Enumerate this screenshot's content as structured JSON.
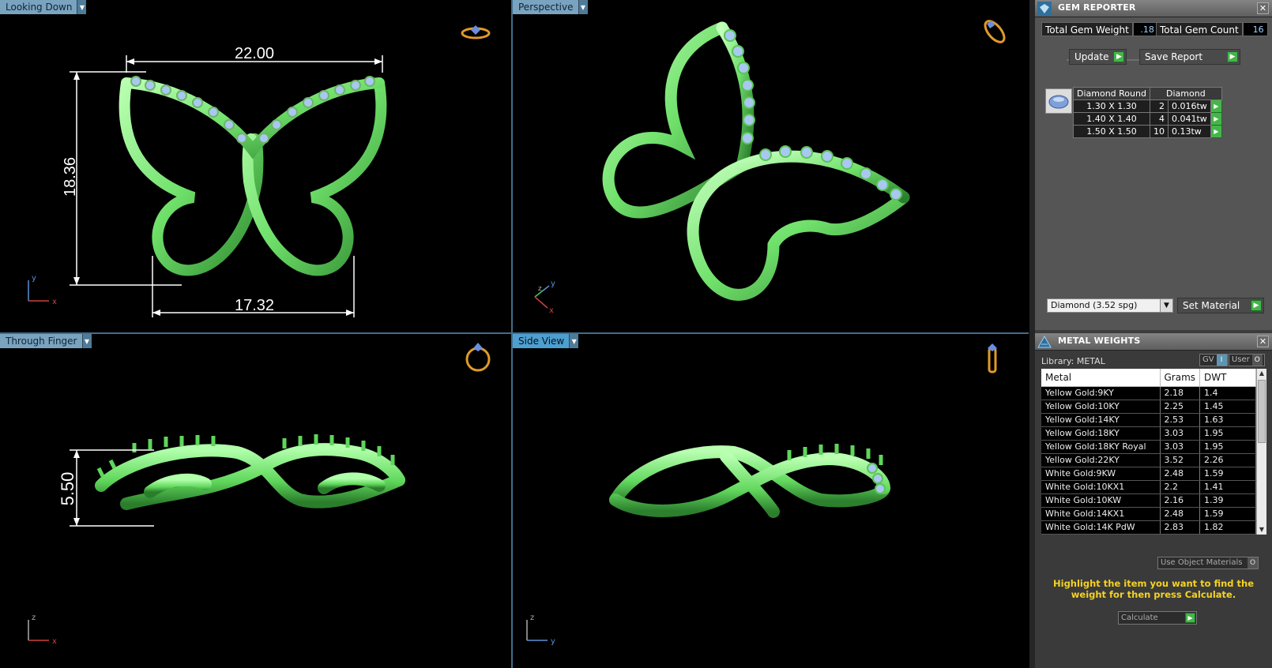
{
  "viewports": {
    "top_left": {
      "label": "Looking Down",
      "dim_width": "22.00",
      "dim_height": "18.36",
      "dim_bottom": "17.32",
      "axis_v": "y",
      "axis_h": "x"
    },
    "top_right": {
      "label": "Perspective",
      "axis_v": "y",
      "axis_z": "z",
      "axis_h": "x"
    },
    "bottom_left": {
      "label": "Through Finger",
      "dim_height": "5.50",
      "axis_v": "z",
      "axis_h": "x"
    },
    "bottom_right": {
      "label": "Side View",
      "axis_v": "z",
      "axis_h": "y"
    }
  },
  "gem_reporter": {
    "title": "GEM REPORTER",
    "close": "✕",
    "total_weight_label": "Total Gem Weight",
    "total_weight_value": ".18",
    "total_count_label": "Total Gem Count",
    "total_count_value": "16",
    "update_label": "Update",
    "save_report_label": "Save Report",
    "table_headers": [
      "Diamond Round",
      "Diamond"
    ],
    "rows": [
      {
        "size": "1.30 X 1.30",
        "count": "2",
        "weight": "0.016tw"
      },
      {
        "size": "1.40 X 1.40",
        "count": "4",
        "weight": "0.041tw"
      },
      {
        "size": "1.50 X 1.50",
        "count": "10",
        "weight": "0.13tw"
      }
    ],
    "material_select": "Diamond    (3.52 spg)",
    "set_material_label": "Set Material"
  },
  "metal_weights": {
    "title": "METAL WEIGHTS",
    "close": "✕",
    "library_label": "Library: METAL",
    "gv_label": "GV",
    "gv_indicator": "I",
    "user_label": "User",
    "user_indicator": "O",
    "headers": [
      "Metal",
      "Grams",
      "DWT"
    ],
    "rows": [
      {
        "metal": "Yellow Gold:9KY",
        "grams": "2.18",
        "dwt": "1.4"
      },
      {
        "metal": "Yellow Gold:10KY",
        "grams": "2.25",
        "dwt": "1.45"
      },
      {
        "metal": "Yellow Gold:14KY",
        "grams": "2.53",
        "dwt": "1.63"
      },
      {
        "metal": "Yellow Gold:18KY",
        "grams": "3.03",
        "dwt": "1.95"
      },
      {
        "metal": "Yellow Gold:18KY Royal",
        "grams": "3.03",
        "dwt": "1.95"
      },
      {
        "metal": "Yellow Gold:22KY",
        "grams": "3.52",
        "dwt": "2.26"
      },
      {
        "metal": "White Gold:9KW",
        "grams": "2.48",
        "dwt": "1.59"
      },
      {
        "metal": "White Gold:10KX1",
        "grams": "2.2",
        "dwt": "1.41"
      },
      {
        "metal": "White Gold:10KW",
        "grams": "2.16",
        "dwt": "1.39"
      },
      {
        "metal": "White Gold:14KX1",
        "grams": "2.48",
        "dwt": "1.59"
      },
      {
        "metal": "White Gold:14K PdW",
        "grams": "2.83",
        "dwt": "1.82"
      }
    ],
    "use_object_materials_label": "Use Object Materials",
    "use_object_indicator": "O",
    "hint": "Highlight the item you want to find the weight for then press Calculate.",
    "calculate_label": "Calculate"
  },
  "colors": {
    "model": "#6fe06a",
    "gem": "#a8c8f0",
    "panel": "#3c3c3c",
    "accent": "#44b649",
    "hint": "#f5d321"
  }
}
